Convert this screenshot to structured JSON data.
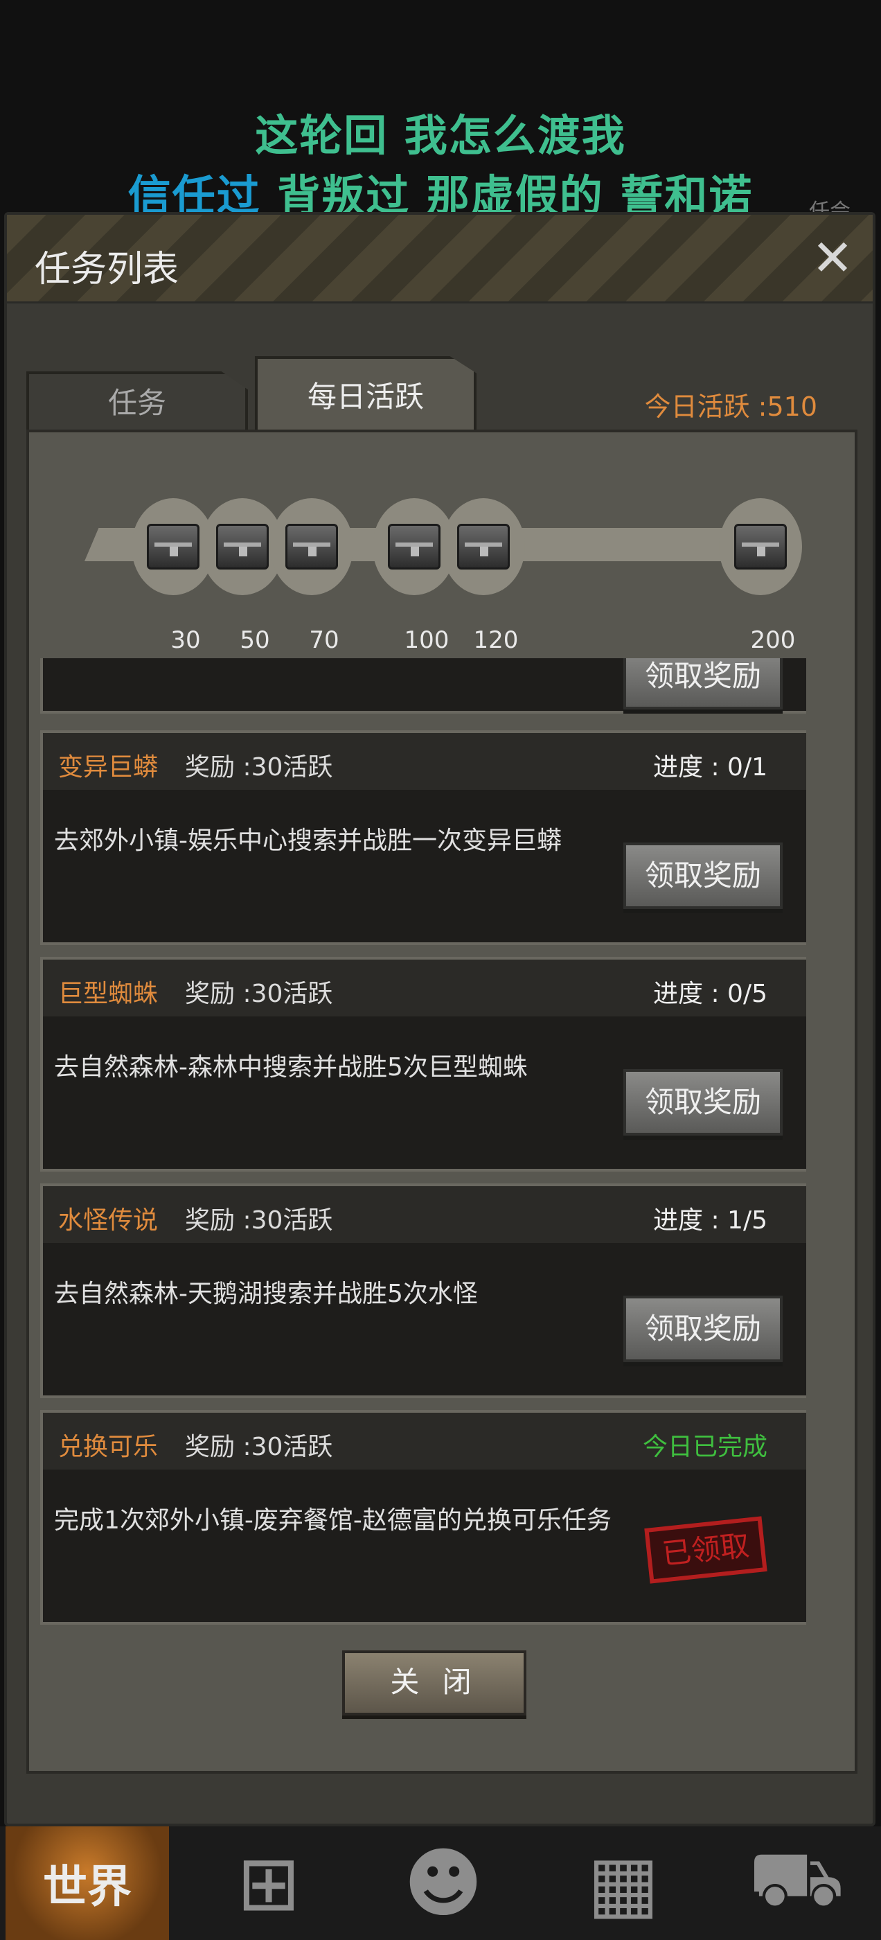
{
  "lyrics": {
    "line1": "这轮回 我怎么渡我",
    "line2_a": "信任过",
    "line2_b": "背叛过 那虚假的 誓和诺"
  },
  "bg_hint": "任会",
  "panel": {
    "title": "任务列表",
    "close_icon": "close-icon"
  },
  "tabs": [
    {
      "label": "任务",
      "active": false
    },
    {
      "label": "每日活跃",
      "active": true
    }
  ],
  "today_active": "今日活跃 :510",
  "milestones": [
    "30",
    "50",
    "70",
    "100",
    "120",
    "200"
  ],
  "partial_task": {
    "button": "领取奖励"
  },
  "tasks": [
    {
      "name": "变异巨蟒",
      "reward": "奖励 :30活跃",
      "progress": "进度 : 0/1",
      "desc": "去郊外小镇-娱乐中心搜索并战胜一次变异巨蟒",
      "button": "领取奖励"
    },
    {
      "name": "巨型蜘蛛",
      "reward": "奖励 :30活跃",
      "progress": "进度 : 0/5",
      "desc": "去自然森林-森林中搜索并战胜5次巨型蜘蛛",
      "button": "领取奖励"
    },
    {
      "name": "水怪传说",
      "reward": "奖励 :30活跃",
      "progress": "进度 : 1/5",
      "desc": "去自然森林-天鹅湖搜索并战胜5次水怪",
      "button": "领取奖励"
    },
    {
      "name": "兑换可乐",
      "reward": "奖励 :30活跃",
      "progress": "今日已完成",
      "desc": "完成1次郊外小镇-废弃餐馆-赵德富的兑换可乐任务",
      "stamp": "已领取"
    }
  ],
  "close_button": "关 闭",
  "bottom_nav": {
    "world": "世界",
    "icons": [
      "backpack-icon",
      "character-icon",
      "phone-icon",
      "cart-icon"
    ]
  },
  "colors": {
    "accent_orange": "#e08b3d",
    "done_green": "#3fbf3f",
    "lyric_green": "#3fbf8f",
    "lyric_blue": "#1a9bd1"
  }
}
